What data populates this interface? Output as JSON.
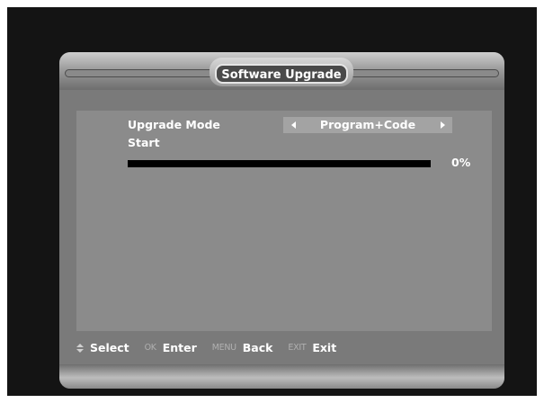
{
  "window": {
    "title": "Software Upgrade"
  },
  "settings": {
    "upgrade_mode": {
      "label": "Upgrade Mode",
      "value": "Program+Code"
    },
    "start": {
      "label": "Start"
    },
    "progress": {
      "percent": 0,
      "text": "0%"
    }
  },
  "footer": {
    "hints": [
      {
        "icon": "up-down-arrows-icon",
        "key": "",
        "label": "Select"
      },
      {
        "key": "OK",
        "label": "Enter"
      },
      {
        "key": "MENU",
        "label": "Back"
      },
      {
        "key": "EXIT",
        "label": "Exit"
      }
    ]
  },
  "colors": {
    "panel": "#7a7a7a",
    "content": "#8b8b8b",
    "selector_highlight": "#a3a3a3",
    "progress_track": "#000000",
    "text": "#ffffff"
  }
}
